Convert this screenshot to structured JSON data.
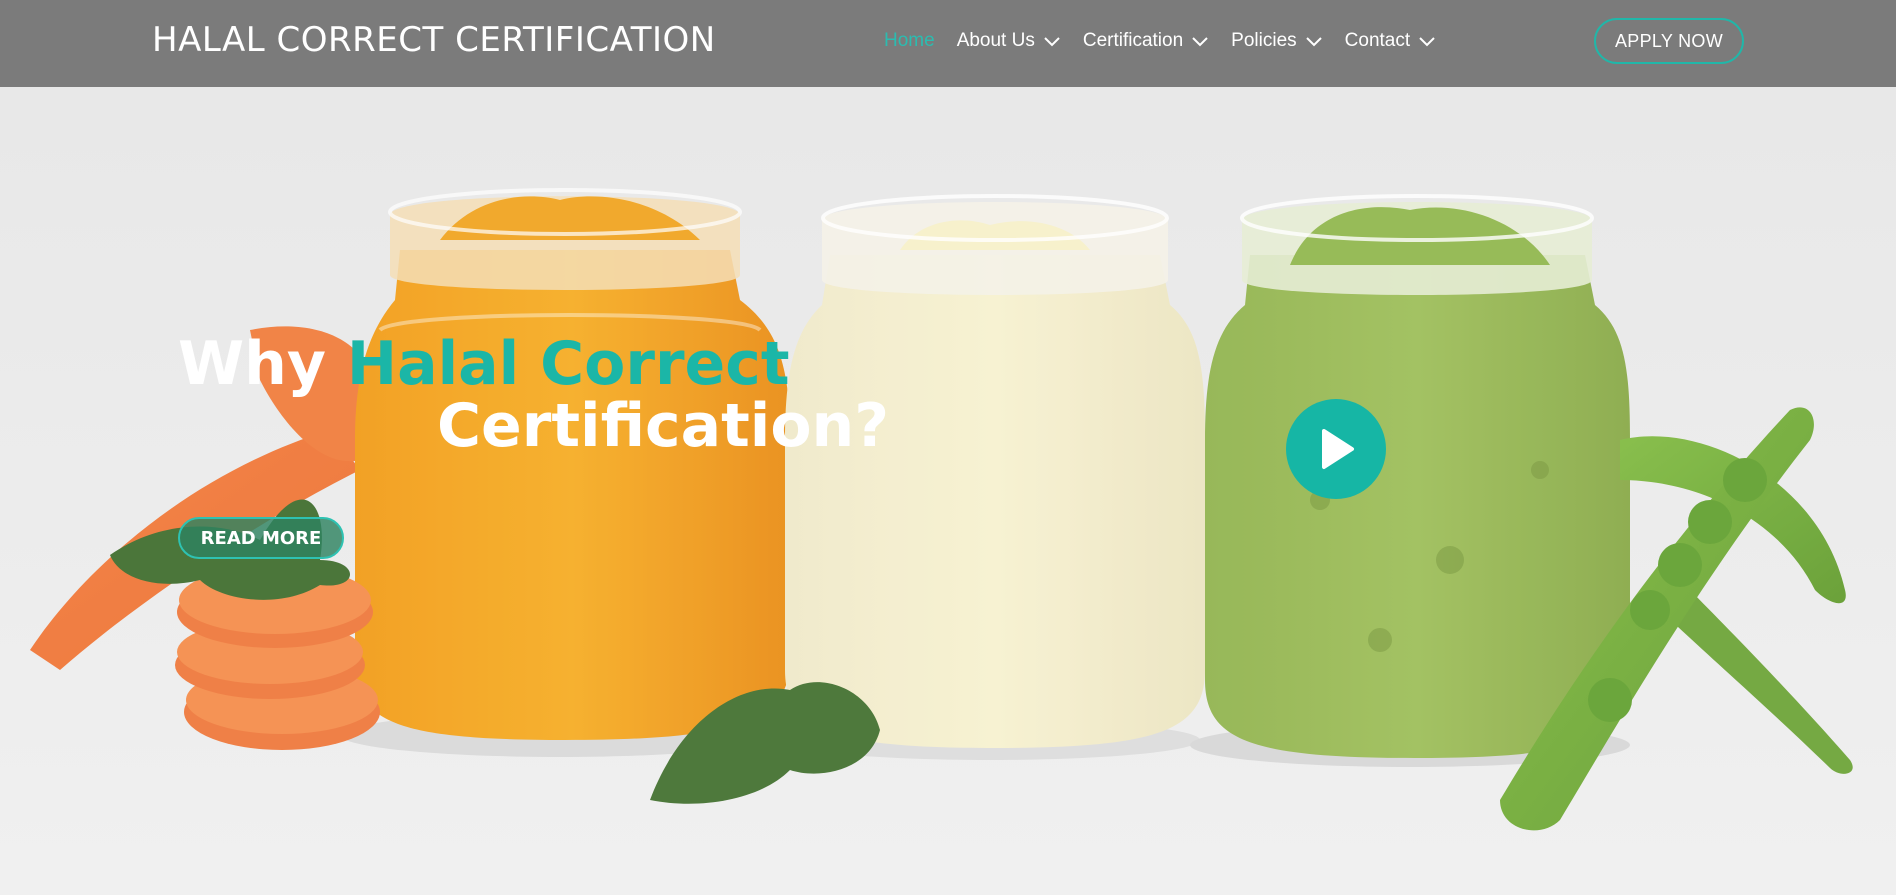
{
  "header": {
    "brand": "HALAL CORRECT CERTIFICATION",
    "nav": [
      {
        "label": "Home",
        "active": true,
        "dropdown": false
      },
      {
        "label": "About Us",
        "active": false,
        "dropdown": true
      },
      {
        "label": "Certification",
        "active": false,
        "dropdown": true
      },
      {
        "label": "Policies",
        "active": false,
        "dropdown": true
      },
      {
        "label": "Contact",
        "active": false,
        "dropdown": true
      }
    ],
    "apply_label": "APPLY NOW"
  },
  "hero": {
    "headline_part1": "Why ",
    "headline_accent": "Halal Correct",
    "headline_part2": "Certification?",
    "read_more_label": "READ MORE",
    "play_icon": "play-icon"
  },
  "colors": {
    "accent": "#1bb6a7",
    "header_bg": "#7b7b7b",
    "text_light": "#ffffff"
  }
}
